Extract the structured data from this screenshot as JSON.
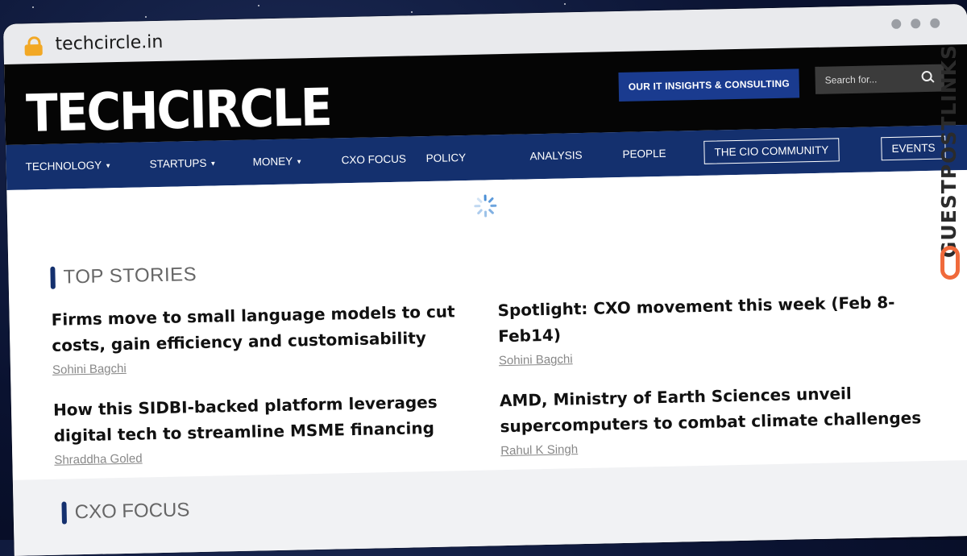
{
  "browser": {
    "url": "techcircle.in"
  },
  "site": {
    "logo": "TECHCIRCLE",
    "consulting_button": "OUR IT INSIGHTS & CONSULTING",
    "search_placeholder": "Search for..."
  },
  "nav": {
    "items": [
      {
        "label": "TECHNOLOGY",
        "caret": "▼"
      },
      {
        "label": "STARTUPS",
        "caret": "▼"
      },
      {
        "label": "MONEY",
        "caret": "▼"
      },
      {
        "label": "CXO FOCUS"
      },
      {
        "label": "POLICY"
      },
      {
        "label": "ANALYSIS"
      },
      {
        "label": "PEOPLE"
      },
      {
        "label": "THE CIO COMMUNITY"
      },
      {
        "label": "EVENTS"
      }
    ]
  },
  "top_stories": {
    "heading": "TOP STORIES",
    "stories": [
      {
        "title": "Firms move to small language models to cut costs, gain efficiency and customisability",
        "author": "Sohini Bagchi"
      },
      {
        "title": "Spotlight: CXO movement this week (Feb 8-Feb14)",
        "author": "Sohini Bagchi"
      },
      {
        "title": "How this SIDBI-backed platform leverages digital tech to streamline MSME financing",
        "author": "Shraddha Goled"
      },
      {
        "title": "AMD, Ministry of Earth Sciences unveil supercomputers to combat climate challenges",
        "author": "Rahul K Singh"
      }
    ]
  },
  "cxo_focus": {
    "heading": "CXO FOCUS"
  },
  "watermark": {
    "text": "GUESTPOSTLINKS"
  },
  "colors": {
    "nav_bg": "#14306e",
    "header_bg": "#050505",
    "accent_orange": "#f06a3b",
    "lock": "#f2a825"
  }
}
